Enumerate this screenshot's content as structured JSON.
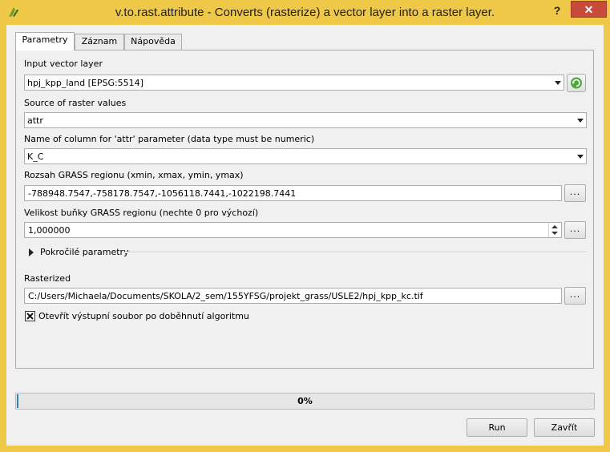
{
  "window": {
    "title": "v.to.rast.attribute - Converts (rasterize) a vector layer into a raster layer.",
    "help_label": "?",
    "close_label": "✕"
  },
  "tabs": [
    {
      "label": "Parametry",
      "active": true
    },
    {
      "label": "Záznam",
      "active": false
    },
    {
      "label": "Nápověda",
      "active": false
    }
  ],
  "params": {
    "input_layer": {
      "label": "Input vector layer",
      "value": "hpj_kpp_land [EPSG:5514]"
    },
    "source": {
      "label": "Source of raster values",
      "value": "attr"
    },
    "column": {
      "label": "Name of column for 'attr' parameter (data type must be numeric)",
      "value": "K_C"
    },
    "region": {
      "label": "Rozsah GRASS regionu (xmin, xmax, ymin, ymax)",
      "value": "-788948.7547,-758178.7547,-1056118.7441,-1022198.7441",
      "button": "..."
    },
    "cellsize": {
      "label": "Velikost buňky GRASS regionu (nechte 0 pro výchozí)",
      "value": "1,000000",
      "button": "..."
    },
    "advanced": {
      "label": "Pokročilé parametry"
    },
    "output": {
      "label": "Rasterized",
      "value": "C:/Users/Michaela/Documents/SKOLA/2_sem/155YFSG/projekt_grass/USLE2/hpj_kpp_kc.tif",
      "button": "..."
    },
    "open_output": {
      "label": "Otevřít výstupní soubor po doběhnutí algoritmu",
      "checked": true
    }
  },
  "progress": {
    "value": 0,
    "text": "0%"
  },
  "buttons": {
    "run": "Run",
    "close": "Zavřít"
  },
  "colors": {
    "titlebar": "#f0c848",
    "close_button": "#c74a3b",
    "progress_fill": "#06b025"
  }
}
